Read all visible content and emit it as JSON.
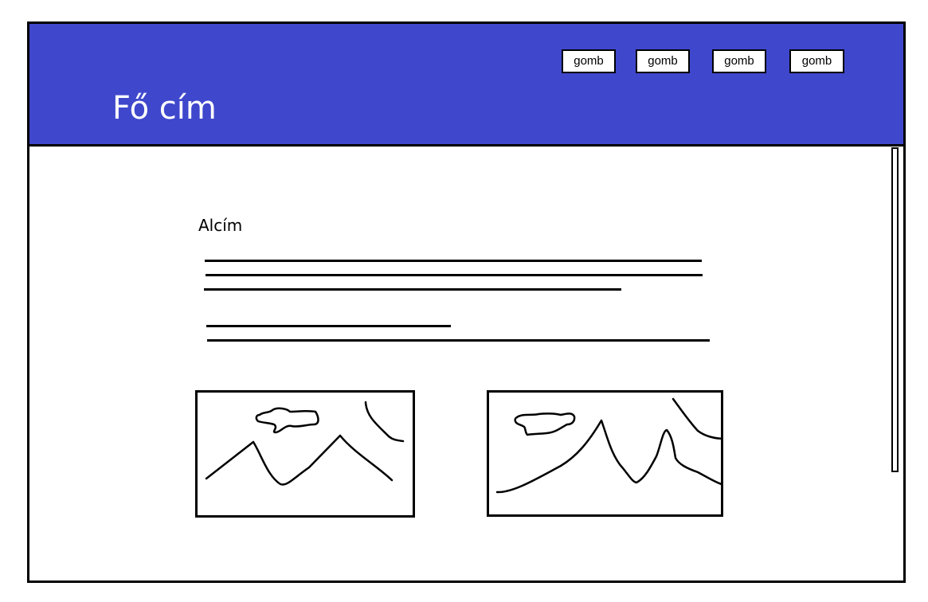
{
  "colors": {
    "header_bg": "#3f48cc",
    "header_text": "#ffffff"
  },
  "header": {
    "title": "Fő cím",
    "buttons": [
      {
        "label": "gomb"
      },
      {
        "label": "gomb"
      },
      {
        "label": "gomb"
      },
      {
        "label": "gomb"
      }
    ]
  },
  "content": {
    "subtitle": "Alcím",
    "images": [
      {
        "icon": "mountain-landscape-icon"
      },
      {
        "icon": "mountain-landscape-icon"
      }
    ]
  }
}
